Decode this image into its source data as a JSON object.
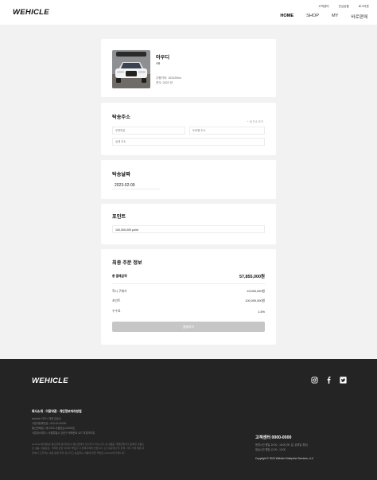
{
  "header": {
    "logo": "WEHICLE",
    "util": [
      "고객센터",
      "관심상품",
      "로그아웃"
    ],
    "nav": [
      {
        "label": "HOME",
        "active": true
      },
      {
        "label": "SHOP",
        "active": false
      },
      {
        "label": "MY",
        "active": false
      },
      {
        "label": "바로판매",
        "active": false
      }
    ]
  },
  "car": {
    "brand": "아우디",
    "model": "A6",
    "mileage": "주행거리: 163420km",
    "year": "연식: 2022 년"
  },
  "address": {
    "title": "탁송주소",
    "search_label": "+ 새 주소 추가",
    "postcode_placeholder": "우편번호",
    "road_placeholder": "도로명 주소",
    "detail_placeholder": "상세 주소"
  },
  "delivery_date": {
    "title": "탁송날짜",
    "value": "2023-02-09"
  },
  "point": {
    "title": "포인트",
    "value": "100,000,000 point"
  },
  "order": {
    "title": "최종 주문 정보",
    "total_label": "총 결제금액",
    "total_value": "57,855,000원",
    "rows": [
      {
        "label": "즉시 구매가",
        "value": "43,000,000원"
      },
      {
        "label": "포인트",
        "value": "100,000,000원"
      },
      {
        "label": "수수료",
        "value": "1.5%"
      }
    ],
    "pay_label": "결제하기"
  },
  "footer": {
    "logo": "WEHICLE",
    "social_icons": [
      "instagram-icon",
      "facebook-icon",
      "twitter-icon"
    ],
    "links": "회사소개 · 이용약관 · 개인정보처리방침",
    "info": [
      "wehicle CEO • 대표 김승수",
      "사업자등록번호 • 000-00-00000",
      "통신판매업 • 제 2023-서울강남-00000호",
      "사업장소재지 • 서울특별시 강남구 테헤란로 427 위워크타워"
    ],
    "notice": "wehicle(위히클)은 통신판매 중개자로서 통신판매의 당사자가 아닙니다. 본 상품은 개별판매자가 등록한 상품으로 상품, 상품정보, 거래에 관한 의무와 책임은 각 판매자에게 있습니다. 단, 이용약관 및 정책, 기타 거래 체결 과정에서 고지하는 내용 등에 따라 검수하고 보증하는 내용에 대한 책임은 wehicle에 있습니다.",
    "cs_title": "고객센터 0000-0000",
    "cs_hours": [
      "운영시간 평일 10:00 - 18:00 (토, 일, 공휴일 휴무)",
      "점심시간 평일 12:00 - 13:00"
    ],
    "copyright": "Copyright © 2023 Wehicle Enterprise Services, LLC"
  }
}
